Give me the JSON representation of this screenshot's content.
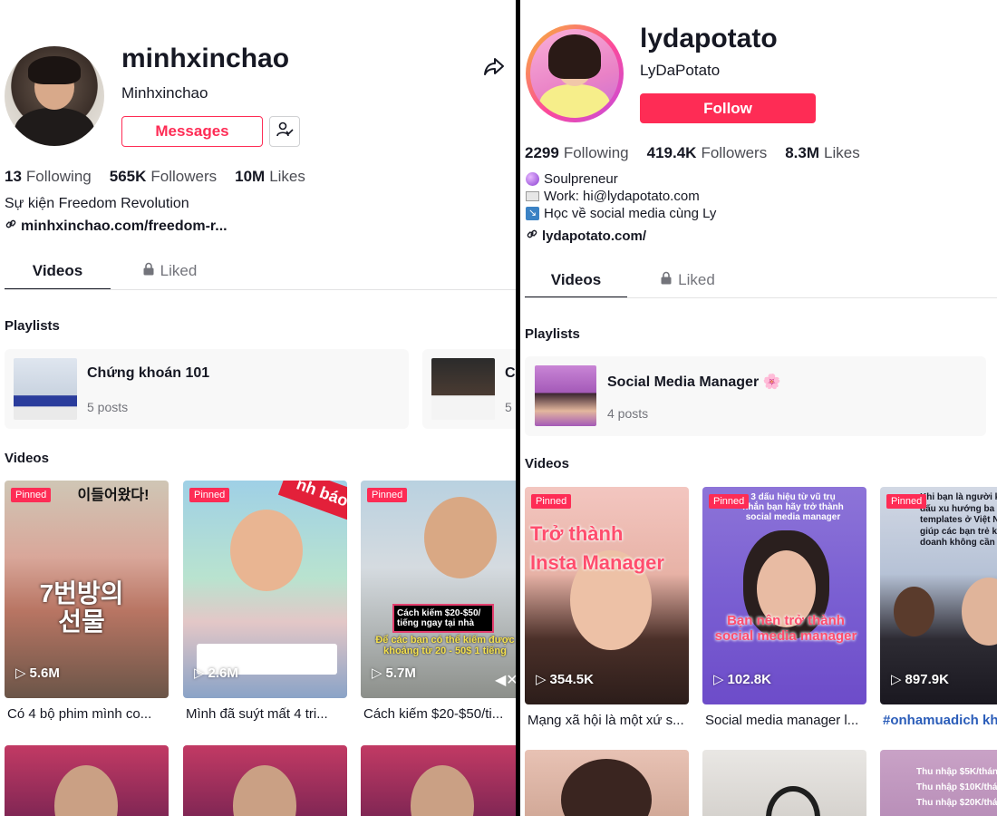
{
  "left": {
    "username": "minhxinchao",
    "nickname": "Minhxinchao",
    "messages_label": "Messages",
    "stats": {
      "following_count": "13",
      "following_label": "Following",
      "followers_count": "565K",
      "followers_label": "Followers",
      "likes_count": "10M",
      "likes_label": "Likes"
    },
    "bio": "Sự kiện Freedom Revolution",
    "link": "minhxinchao.com/freedom-r...",
    "tabs": {
      "videos": "Videos",
      "liked": "Liked"
    },
    "playlists_title": "Playlists",
    "playlists": [
      {
        "title": "Chứng khoán 101",
        "count": "5 posts"
      },
      {
        "title": "Cá",
        "count": "5"
      }
    ],
    "videos_title": "Videos",
    "videos": [
      {
        "pinned": "Pinned",
        "views": "5.6M",
        "caption": "Có 4 bộ phim mình co...",
        "overlay_top": "이들어왔다!",
        "overlay_bottom": "7번방의\n선물"
      },
      {
        "pinned": "Pinned",
        "views": "2.6M",
        "caption": "Mình đã suýt mất 4 tri...",
        "overlay_top": "nh báo",
        "overlay_bottom": ""
      },
      {
        "pinned": "Pinned",
        "views": "5.7M",
        "caption": "Cách kiếm $20-$50/ti...",
        "overlay_top": "Cách kiếm $20-$50/\ntiếng ngay tại nhà",
        "overlay_bottom": "Để các bạn có thể kiếm được\nkhoảng từ 20 - 50$ 1 tiếng"
      }
    ]
  },
  "right": {
    "username": "lydapotato",
    "nickname": "LyDaPotato",
    "follow_label": "Follow",
    "stats": {
      "following_count": "2299",
      "following_label": "Following",
      "followers_count": "419.4K",
      "followers_label": "Followers",
      "likes_count": "8.3M",
      "likes_label": "Likes"
    },
    "bio_lines": [
      "Soulpreneur",
      "Work: hi@lydapotato.com",
      "Học về social media cùng Ly"
    ],
    "link": "lydapotato.com/",
    "tabs": {
      "videos": "Videos",
      "liked": "Liked"
    },
    "playlists_title": "Playlists",
    "playlists": [
      {
        "title": "Social Media Manager 🌸",
        "count": "4 posts"
      }
    ],
    "videos_title": "Videos",
    "videos": [
      {
        "pinned": "Pinned",
        "views": "354.5K",
        "caption": "Mạng xã hội là một xứ s...",
        "overlay_top": "Trở thành\nInsta Manager",
        "overlay_bottom": ""
      },
      {
        "pinned": "Pinned",
        "views": "102.8K",
        "caption": "Social media manager l...",
        "overlay_top": "3 dấu hiệu từ vũ trụ\nnhắn bạn hãy trở thành\nsocial media manager",
        "overlay_bottom": "Bạn nên trở thành\nsocial media manager"
      },
      {
        "pinned": "Pinned",
        "views": "897.9K",
        "caption": "#onhamuadich kh",
        "overlay_top": "Khi bạn là người k\ndấu xu hướng ba\ntemplates ở Việt N\ngiúp các bạn trẻ k\ndoanh không cần v",
        "overlay_bottom": ""
      }
    ],
    "bottom_overlay": "Thu nhập $5K/thán\nThu nhập $10K/thán\nThu nhập $20K/thán"
  }
}
